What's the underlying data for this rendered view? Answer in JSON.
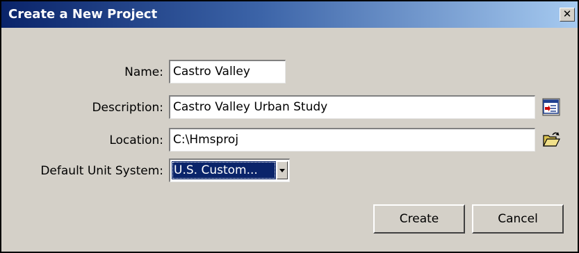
{
  "window": {
    "title": "Create a New Project",
    "close_glyph": "✕"
  },
  "form": {
    "name_label": "Name:",
    "name_value": "Castro Valley",
    "description_label": "Description:",
    "description_value": "Castro Valley Urban Study",
    "location_label": "Location:",
    "location_value": "C:\\Hmsproj",
    "unit_label": "Default Unit System:",
    "unit_value": "U.S. Custom..."
  },
  "icons": {
    "description_button": "edit-description-icon",
    "location_button": "open-folder-icon",
    "unit_dropdown": "chevron-down-icon"
  },
  "buttons": {
    "create": "Create",
    "cancel": "Cancel"
  },
  "colors": {
    "dialog_background": "#d4d0c8",
    "titlebar_start": "#0a246a",
    "titlebar_end": "#a6caf0",
    "selection": "#0a246a"
  }
}
